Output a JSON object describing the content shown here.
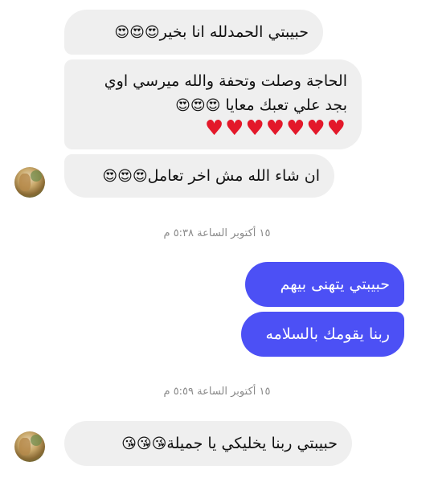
{
  "messages": {
    "m1": {
      "text": "حبيبتي الحمدلله انا بخير",
      "emoji": "😍😍😍"
    },
    "m2": {
      "line1": "الحاجة وصلت وتحفة والله ميرسي اوي",
      "line2": "بجد علي تعبك معايا",
      "line2_emoji": "😍😍😍",
      "hearts": "♥♥♥♥♥♥♥"
    },
    "m3": {
      "text": "ان شاء الله مش اخر تعامل",
      "emoji": "😍😍😍"
    },
    "timestamp1": "١٥ أكتوبر الساعة ٥:٣٨ م",
    "m4": {
      "text": "حبيبتي يتهنى بيهم"
    },
    "m5": {
      "text": "ربنا يقومك بالسلامه"
    },
    "timestamp2": "١٥ أكتوبر الساعة ٥:٥٩ م",
    "m6": {
      "text": "حبيبتي ربنا يخليكي يا جميلة",
      "emoji": "😘😘😘"
    }
  },
  "colors": {
    "incoming_bubble": "#efefef",
    "outgoing_bubble": "#4c50f5",
    "timestamp": "#8a8a8a",
    "heart": "#e3182a"
  }
}
